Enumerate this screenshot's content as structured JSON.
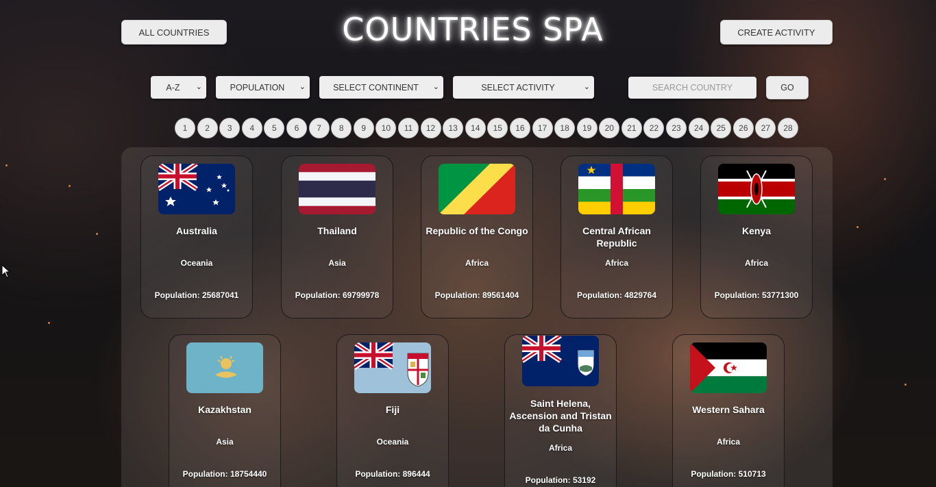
{
  "header": {
    "title": "COUNTRIES SPA",
    "all_countries_label": "ALL COUNTRIES",
    "create_activity_label": "CREATE ACTIVITY"
  },
  "filters": {
    "order": "A-Z",
    "population": "POPULATION",
    "continent": "SELECT CONTINENT",
    "activity": "SELECT ACTIVITY",
    "search_placeholder": "SEARCH COUNTRY",
    "go_label": "GO"
  },
  "pagination": [
    "1",
    "2",
    "3",
    "4",
    "5",
    "6",
    "7",
    "8",
    "9",
    "10",
    "11",
    "12",
    "13",
    "14",
    "15",
    "16",
    "17",
    "18",
    "19",
    "20",
    "21",
    "22",
    "23",
    "24",
    "25",
    "26",
    "27",
    "28"
  ],
  "countries": [
    {
      "name": "Australia",
      "continent": "Oceania",
      "population": "Population: 25687041",
      "flag": "australia-flag"
    },
    {
      "name": "Thailand",
      "continent": "Asia",
      "population": "Population: 69799978",
      "flag": "thailand-flag"
    },
    {
      "name": "Republic of the Congo",
      "continent": "Africa",
      "population": "Population: 89561404",
      "flag": "congo-flag"
    },
    {
      "name": "Central African Republic",
      "continent": "Africa",
      "population": "Population: 4829764",
      "flag": "central-african-republic-flag"
    },
    {
      "name": "Kenya",
      "continent": "Africa",
      "population": "Population: 53771300",
      "flag": "kenya-flag"
    },
    {
      "name": "Kazakhstan",
      "continent": "Asia",
      "population": "Population: 18754440",
      "flag": "kazakhstan-flag"
    },
    {
      "name": "Fiji",
      "continent": "Oceania",
      "population": "Population: 896444",
      "flag": "fiji-flag"
    },
    {
      "name": "Saint Helena, Ascension and Tristan da Cunha",
      "continent": "Africa",
      "population": "Population: 53192",
      "flag": "saint-helena-flag"
    },
    {
      "name": "Western Sahara",
      "continent": "Africa",
      "population": "Population: 510713",
      "flag": "western-sahara-flag"
    }
  ],
  "icons": {
    "select_chevron": "chevron-down-icon"
  }
}
